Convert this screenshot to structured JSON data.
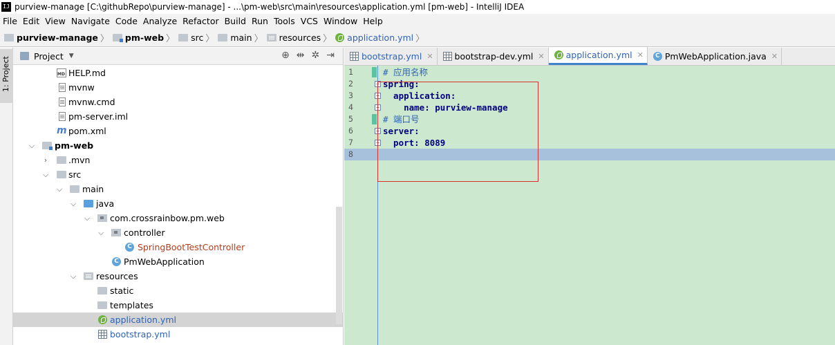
{
  "window": {
    "title": "purview-manage [C:\\githubRepo\\purview-manage] - ...\\pm-web\\src\\main\\resources\\application.yml [pm-web] - IntelliJ IDEA",
    "app_icon": "IJ"
  },
  "menu": [
    "File",
    "Edit",
    "View",
    "Navigate",
    "Code",
    "Analyze",
    "Refactor",
    "Build",
    "Run",
    "Tools",
    "VCS",
    "Window",
    "Help"
  ],
  "breadcrumb": [
    "purview-manage",
    "pm-web",
    "src",
    "main",
    "resources",
    "application.yml"
  ],
  "stripe": {
    "label": "1: Project"
  },
  "project_panel": {
    "title": "Project",
    "tree": [
      {
        "label": "HELP.md",
        "icon": "markdown-file-icon",
        "color": "normal"
      },
      {
        "label": "mvnw",
        "icon": "text-file-icon",
        "color": "normal"
      },
      {
        "label": "mvnw.cmd",
        "icon": "text-file-icon",
        "color": "normal"
      },
      {
        "label": "pm-server.iml",
        "icon": "text-file-icon",
        "color": "normal"
      },
      {
        "label": "pom.xml",
        "icon": "maven-icon",
        "color": "normal"
      },
      {
        "label": "pm-web",
        "icon": "module-folder-icon",
        "color": "bold"
      },
      {
        "label": ".mvn",
        "icon": "folder-icon",
        "color": "normal"
      },
      {
        "label": "src",
        "icon": "folder-icon",
        "color": "normal"
      },
      {
        "label": "main",
        "icon": "folder-icon",
        "color": "normal"
      },
      {
        "label": "java",
        "icon": "source-folder-icon",
        "color": "normal"
      },
      {
        "label": "com.crossrainbow.pm.web",
        "icon": "package-icon",
        "color": "normal"
      },
      {
        "label": "controller",
        "icon": "package-icon",
        "color": "normal"
      },
      {
        "label": "SpringBootTestController",
        "icon": "class-icon",
        "color": "red"
      },
      {
        "label": "PmWebApplication",
        "icon": "spring-boot-class-icon",
        "color": "normal"
      },
      {
        "label": "resources",
        "icon": "resources-folder-icon",
        "color": "normal"
      },
      {
        "label": "static",
        "icon": "folder-icon",
        "color": "normal"
      },
      {
        "label": "templates",
        "icon": "folder-icon",
        "color": "normal"
      },
      {
        "label": "application.yml",
        "icon": "spring-config-icon",
        "color": "blue"
      },
      {
        "label": "bootstrap.yml",
        "icon": "yaml-file-icon",
        "color": "blue"
      }
    ]
  },
  "editor": {
    "tabs": [
      {
        "label": "bootstrap.yml",
        "active": false
      },
      {
        "label": "bootstrap-dev.yml",
        "active": false
      },
      {
        "label": "application.yml",
        "active": true
      },
      {
        "label": "PmWebApplication.java",
        "active": false
      }
    ],
    "lines": [
      {
        "num": "1",
        "text": "# 应用名称"
      },
      {
        "num": "2",
        "text": "spring:"
      },
      {
        "num": "3",
        "text": "  application:"
      },
      {
        "num": "4",
        "text": "    name: purview-manage"
      },
      {
        "num": "5",
        "text": "# 端口号"
      },
      {
        "num": "6",
        "text": "server:"
      },
      {
        "num": "7",
        "text": "  port: 8089"
      },
      {
        "num": "8",
        "text": ""
      }
    ]
  },
  "colors": {
    "editor_bg": "#cce8cf",
    "current_line": "#a7c0db",
    "highlight_box": "#d9312f"
  }
}
